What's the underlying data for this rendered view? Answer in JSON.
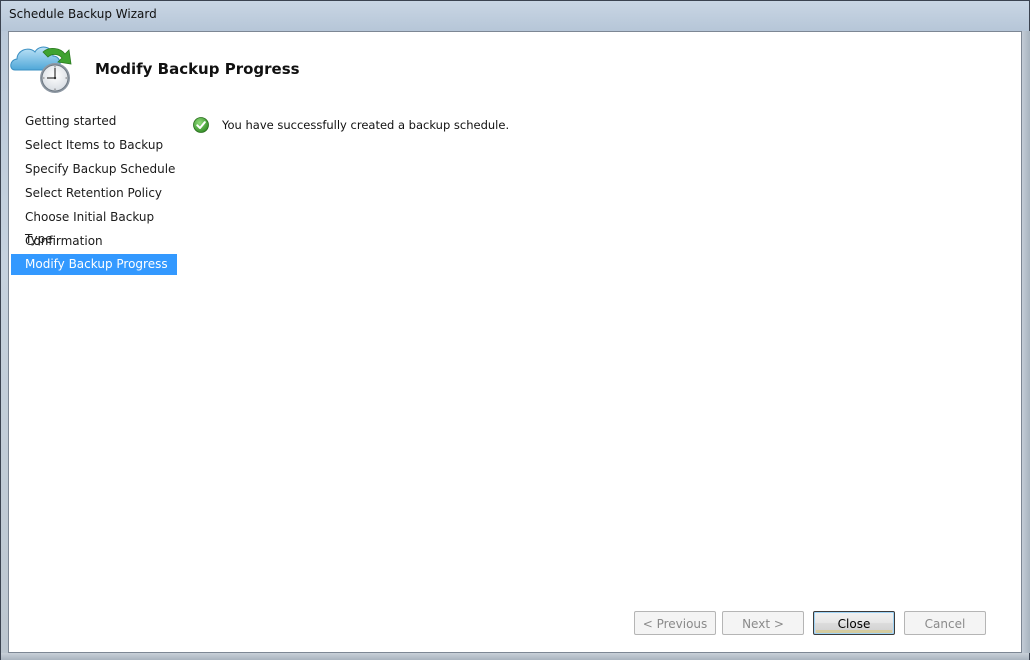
{
  "window": {
    "title": "Schedule Backup Wizard"
  },
  "header": {
    "title": "Modify Backup Progress",
    "icon": "cloud-clock-icon"
  },
  "nav": {
    "items": [
      {
        "label": "Getting started"
      },
      {
        "label": "Select Items to Backup"
      },
      {
        "label": "Specify Backup Schedule"
      },
      {
        "label": "Select Retention Policy"
      },
      {
        "label": "Choose Initial Backup Type"
      },
      {
        "label": "Confirmation"
      },
      {
        "label": "Modify Backup Progress",
        "selected": true
      }
    ]
  },
  "main": {
    "status_icon": "success-check-icon",
    "status_message": "You have successfully created a backup schedule."
  },
  "buttons": {
    "previous": "< Previous",
    "next": "Next >",
    "close": "Close",
    "cancel": "Cancel"
  },
  "colors": {
    "selection": "#3399ff",
    "success": "#3a9a2a"
  }
}
